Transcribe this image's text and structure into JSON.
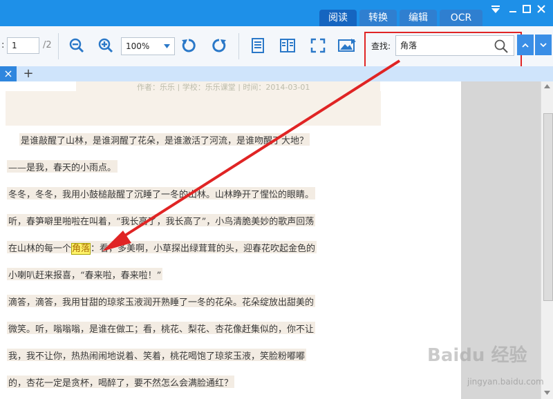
{
  "tabs": [
    {
      "label": "阅读",
      "active": true
    },
    {
      "label": "转换",
      "active": false
    },
    {
      "label": "编辑",
      "active": false
    },
    {
      "label": "OCR",
      "active": false
    }
  ],
  "toolbar": {
    "page_label_prefix": ":",
    "page_current": "1",
    "page_total": "/2",
    "zoom_value": "100%",
    "search_label": "查找:",
    "search_value": "角落"
  },
  "doc_tab": {
    "close_symbol": "×",
    "add_symbol": "+"
  },
  "document": {
    "meta": "作者：乐乐 | 学校：乐乐课堂 | 时间：2014-03-01",
    "lines": [
      "是谁敲醒了山林，是谁洞醒了花朵，是谁激活了河流，是谁吻醒了大地？",
      "——是我，春天的小雨点。",
      "冬冬，冬冬，我用小鼓槌敲醒了沉睡了一冬的山林。山林睁开了惺忪的眼睛。",
      "听，春笋噼里啪啦在叫着，“我长高了，我长高了”，小鸟清脆美妙的歌声回荡",
      "小喇叭赶来报喜，“春来啦，春来啦！”",
      "滴答，滴答，我用甘甜的琼浆玉液润开熟睡了一冬的花朵。花朵绽放出甜美的",
      "微笑。听，嗡嗡嗡，是谁在做工；看，桃花、梨花、杏花像赶集似的，你不让",
      "我，我不让你，热热闹闹地说着、笑着，桃花喝饱了琼浆玉液，笑脸粉嘟嘟",
      "的，杏花一定是贪杯，喝醉了，要不然怎么会满脸通红？"
    ],
    "highlight_line": {
      "before": "在山林的每一个",
      "match": "角落",
      "after": "：看，多美啊，小草探出绿茸茸的头，迎春花吹起金色的"
    }
  },
  "watermark": {
    "brand": "Baidu 经验",
    "url": "jingyan.baidu.com"
  },
  "colors": {
    "accent": "#1e90e8",
    "annotation": "#e02424",
    "highlight": "#fff36a"
  }
}
